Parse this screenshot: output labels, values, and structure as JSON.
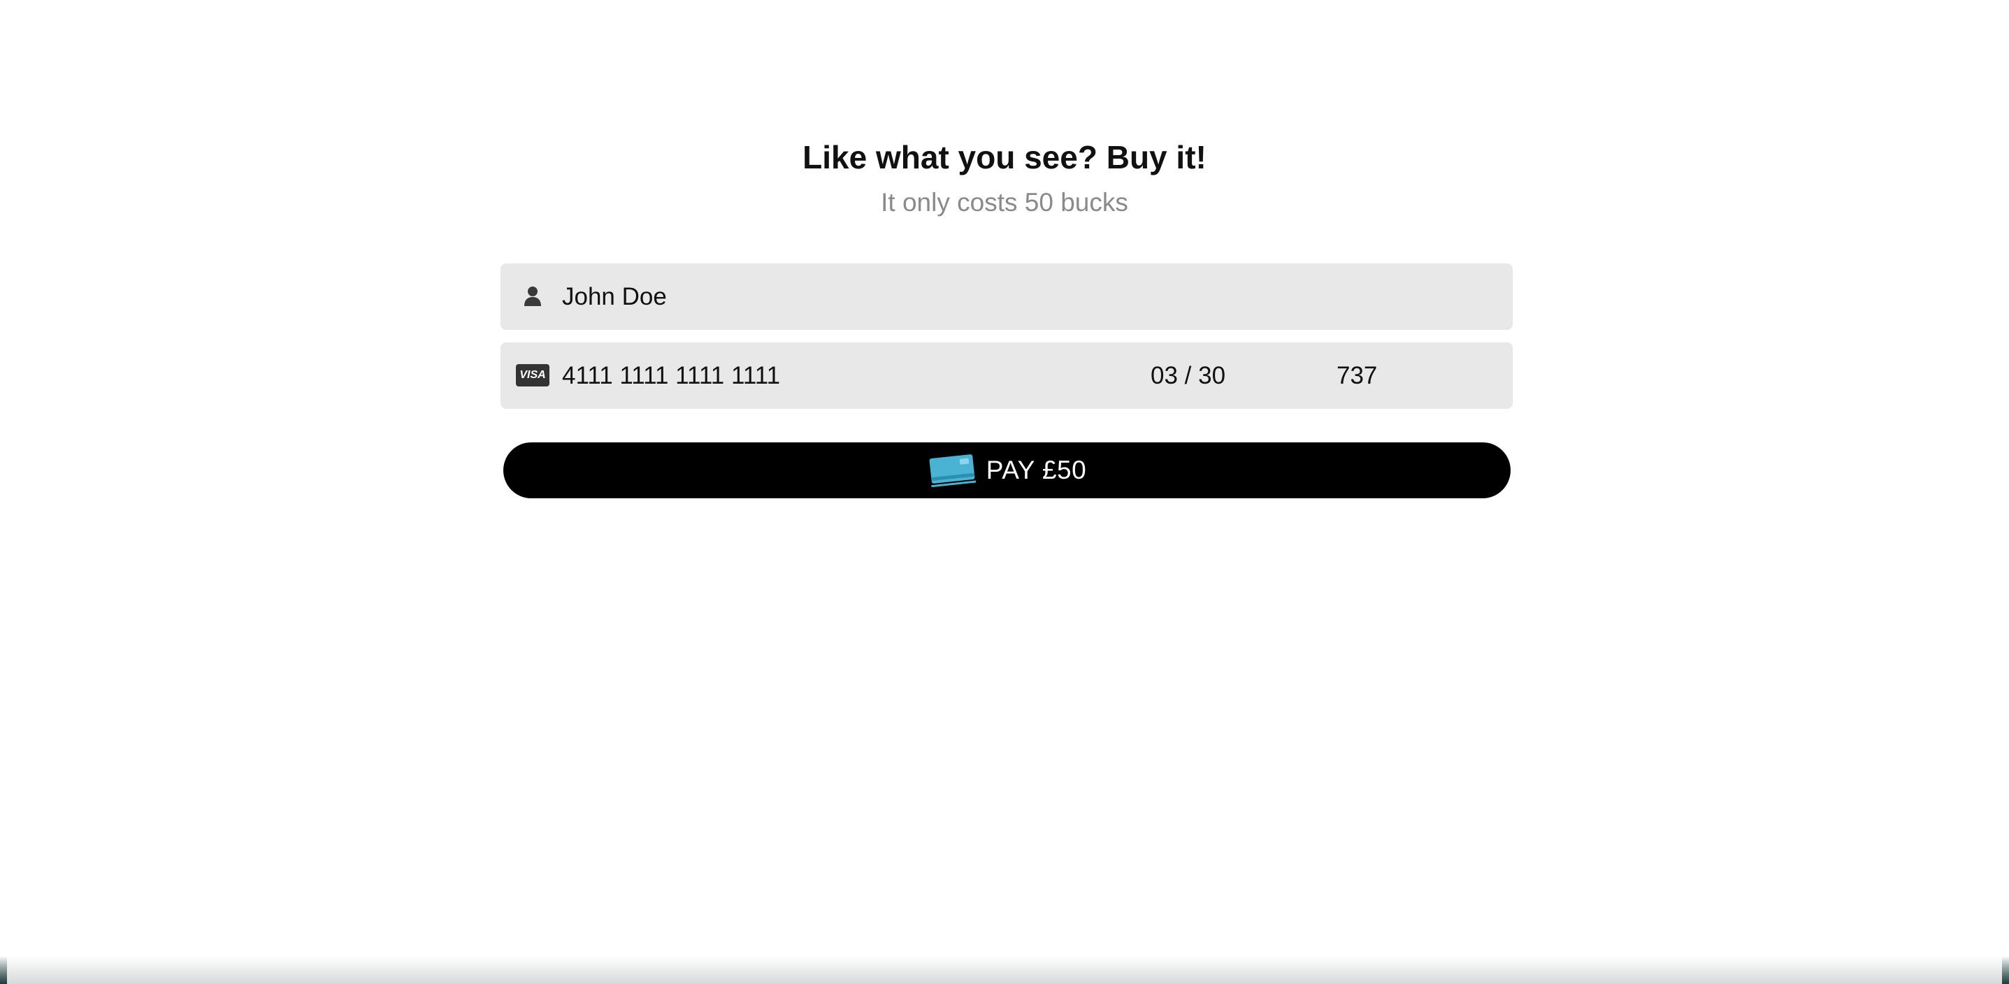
{
  "header": {
    "title": "Like what you see? Buy it!",
    "subtitle": "It only costs 50 bucks"
  },
  "form": {
    "cardholder": {
      "icon": "user-icon",
      "value": "John Doe"
    },
    "card": {
      "brand_icon": "visa-icon",
      "brand_label": "VISA",
      "number": "4111 1111 1111 1111",
      "expiry": "03 / 30",
      "cvc": "737"
    },
    "pay_button": {
      "icon": "credit-card-icon",
      "label": "PAY £50"
    }
  },
  "colors": {
    "field_background": "#e8e8e8",
    "button_background": "#000000",
    "card_icon": "#4ab3d4",
    "subtitle": "#8a8a8a"
  }
}
